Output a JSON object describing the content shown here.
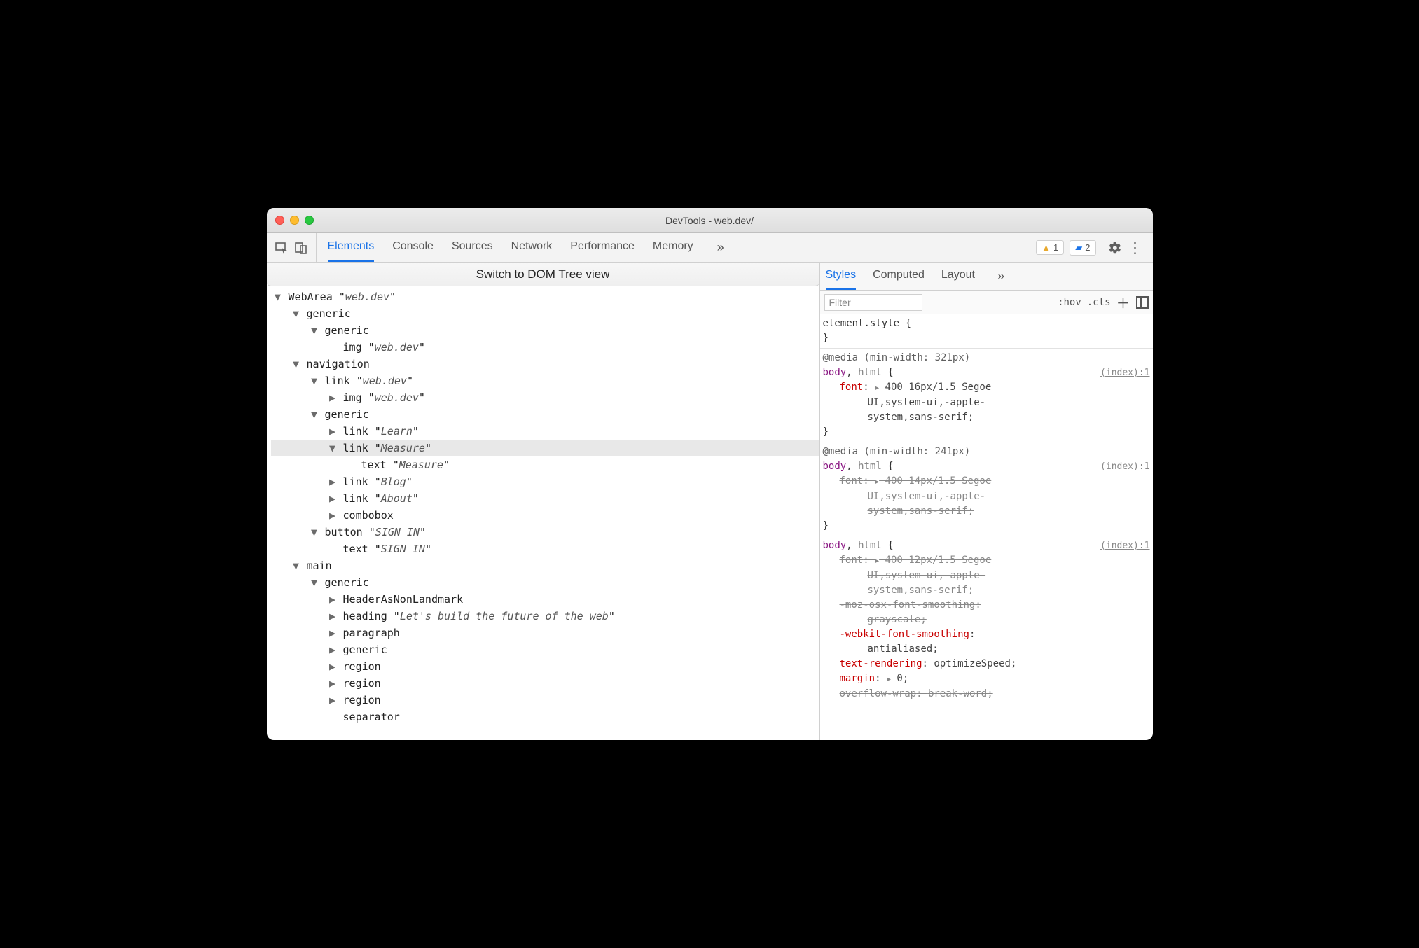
{
  "window": {
    "title": "DevTools - web.dev/"
  },
  "toolbar": {
    "tabs": [
      "Elements",
      "Console",
      "Sources",
      "Network",
      "Performance",
      "Memory"
    ],
    "more": "»",
    "warnings": "1",
    "issues": "2"
  },
  "toggle_bar": "Switch to DOM Tree view",
  "tree": [
    {
      "d": 0,
      "a": "open",
      "role": "WebArea",
      "name": "web.dev"
    },
    {
      "d": 1,
      "a": "open",
      "role": "generic"
    },
    {
      "d": 2,
      "a": "open",
      "role": "generic"
    },
    {
      "d": 3,
      "a": "none",
      "role": "img",
      "name": "web.dev"
    },
    {
      "d": 1,
      "a": "open",
      "role": "navigation"
    },
    {
      "d": 2,
      "a": "open",
      "role": "link",
      "name": "web.dev"
    },
    {
      "d": 3,
      "a": "closed",
      "role": "img",
      "name": "web.dev"
    },
    {
      "d": 2,
      "a": "open",
      "role": "generic"
    },
    {
      "d": 3,
      "a": "closed",
      "role": "link",
      "name": "Learn"
    },
    {
      "d": 3,
      "a": "open",
      "role": "link",
      "name": "Measure",
      "hl": true
    },
    {
      "d": 4,
      "a": "none",
      "role": "text",
      "name": "Measure"
    },
    {
      "d": 3,
      "a": "closed",
      "role": "link",
      "name": "Blog"
    },
    {
      "d": 3,
      "a": "closed",
      "role": "link",
      "name": "About"
    },
    {
      "d": 3,
      "a": "closed",
      "role": "combobox"
    },
    {
      "d": 2,
      "a": "open",
      "role": "button",
      "name": "SIGN IN"
    },
    {
      "d": 3,
      "a": "none",
      "role": "text",
      "name": "SIGN IN"
    },
    {
      "d": 1,
      "a": "open",
      "role": "main"
    },
    {
      "d": 2,
      "a": "open",
      "role": "generic"
    },
    {
      "d": 3,
      "a": "closed",
      "role": "HeaderAsNonLandmark"
    },
    {
      "d": 3,
      "a": "closed",
      "role": "heading",
      "name": "Let's build the future of the web"
    },
    {
      "d": 3,
      "a": "closed",
      "role": "paragraph"
    },
    {
      "d": 3,
      "a": "closed",
      "role": "generic"
    },
    {
      "d": 3,
      "a": "closed",
      "role": "region"
    },
    {
      "d": 3,
      "a": "closed",
      "role": "region"
    },
    {
      "d": 3,
      "a": "closed",
      "role": "region"
    },
    {
      "d": 3,
      "a": "none",
      "role": "separator"
    }
  ],
  "styles_tabs": {
    "items": [
      "Styles",
      "Computed",
      "Layout"
    ],
    "more": "»"
  },
  "filter": {
    "placeholder": "Filter",
    "hov": ":hov",
    "cls": ".cls"
  },
  "rules": {
    "element_style": "element.style {",
    "close_brace": "}",
    "r1": {
      "media": "@media (min-width: 321px)",
      "sel_body": "body",
      "sel_html": "html",
      "src": "(index):1",
      "prop": "font",
      "tri": "▶",
      "val1": "400 16px/1.5 Segoe",
      "val2": "UI,system-ui,-apple-",
      "val3": "system,sans-serif;"
    },
    "r2": {
      "media": "@media (min-width: 241px)",
      "sel_body": "body",
      "sel_html": "html",
      "src": "(index):1",
      "prop": "font",
      "tri": "▶",
      "val1": "400 14px/1.5 Segoe",
      "val2": "UI,system-ui,-apple-",
      "val3": "system,sans-serif;"
    },
    "r3": {
      "sel_body": "body",
      "sel_html": "html",
      "src": "(index):1",
      "p1_prop": "font",
      "p1_tri": "▶",
      "p1_v1": "400 12px/1.5 Segoe",
      "p1_v2": "UI,system-ui,-apple-",
      "p1_v3": "system,sans-serif;",
      "p2_prop": "-moz-osx-font-smoothing",
      "p2_val": "grayscale;",
      "p3_prop": "-webkit-font-smoothing",
      "p3_val": "antialiased;",
      "p4_prop": "text-rendering",
      "p4_val": "optimizeSpeed;",
      "p5_prop": "margin",
      "p5_tri": "▶",
      "p5_val": "0;",
      "p6_prop": "overflow-wrap",
      "p6_val": "break-word;"
    }
  }
}
